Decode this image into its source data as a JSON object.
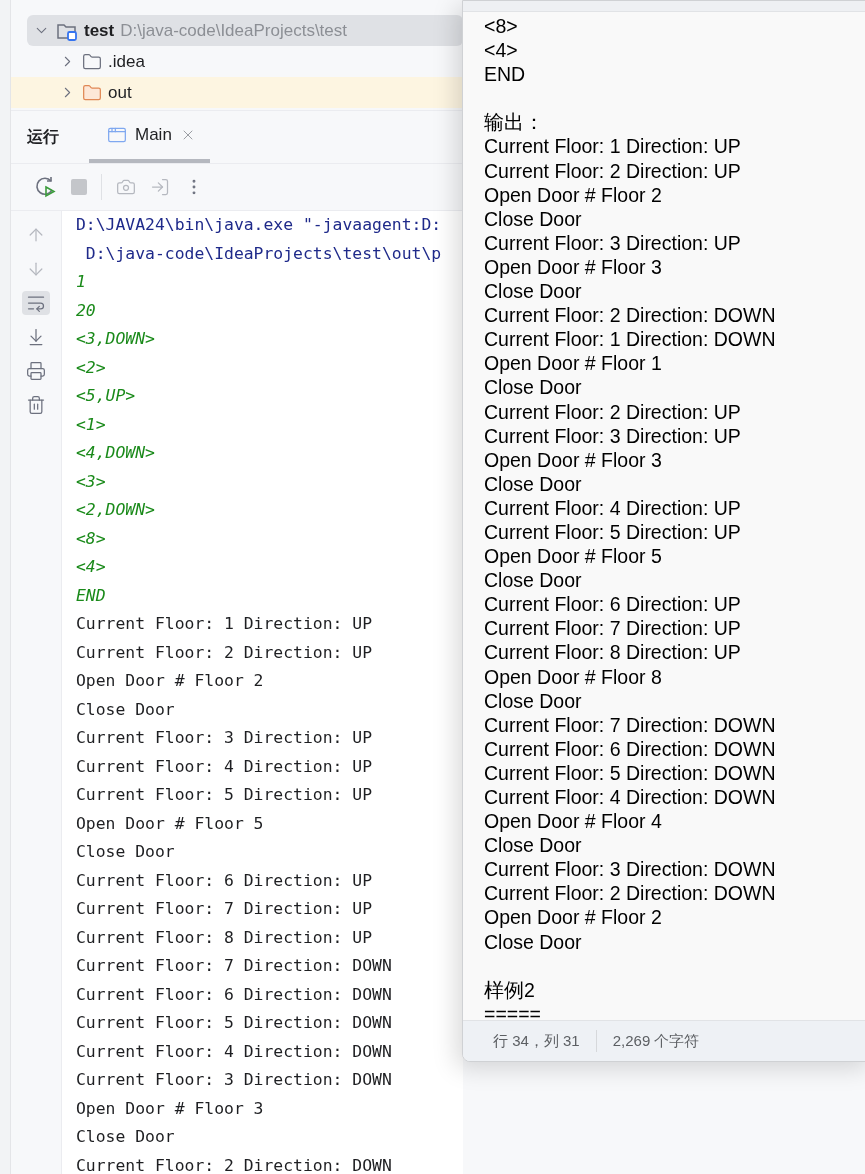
{
  "project_tree": [
    {
      "kind": "project",
      "name": "test",
      "path": "D:\\java-code\\IdeaProjects\\test",
      "expanded": true,
      "selected": true,
      "children": [
        {
          "kind": "folder",
          "name": ".idea",
          "expanded": false,
          "selected": false
        },
        {
          "kind": "excluded",
          "name": "out",
          "expanded": false,
          "selected": false
        }
      ]
    }
  ],
  "run_panel": {
    "title": "运行",
    "tabs": [
      {
        "label": "Main",
        "selected": true
      }
    ]
  },
  "console": {
    "lines": [
      {
        "kind": "command",
        "text": "D:\\JAVA24\\bin\\java.exe \"-javaagent:D:"
      },
      {
        "kind": "command",
        "text": " D:\\java-code\\IdeaProjects\\test\\out\\p"
      },
      {
        "kind": "input",
        "text": "1"
      },
      {
        "kind": "input",
        "text": "20"
      },
      {
        "kind": "input",
        "text": "<3,DOWN>"
      },
      {
        "kind": "input",
        "text": "<2>"
      },
      {
        "kind": "input",
        "text": "<5,UP>"
      },
      {
        "kind": "input",
        "text": "<1>"
      },
      {
        "kind": "input",
        "text": "<4,DOWN>"
      },
      {
        "kind": "input",
        "text": "<3>"
      },
      {
        "kind": "input",
        "text": "<2,DOWN>"
      },
      {
        "kind": "input",
        "text": "<8>"
      },
      {
        "kind": "input",
        "text": "<4>"
      },
      {
        "kind": "input",
        "text": "END"
      },
      {
        "kind": "output",
        "text": "Current Floor: 1 Direction: UP"
      },
      {
        "kind": "output",
        "text": "Current Floor: 2 Direction: UP"
      },
      {
        "kind": "output",
        "text": "Open Door # Floor 2"
      },
      {
        "kind": "output",
        "text": "Close Door"
      },
      {
        "kind": "output",
        "text": "Current Floor: 3 Direction: UP"
      },
      {
        "kind": "output",
        "text": "Current Floor: 4 Direction: UP"
      },
      {
        "kind": "output",
        "text": "Current Floor: 5 Direction: UP"
      },
      {
        "kind": "output",
        "text": "Open Door # Floor 5"
      },
      {
        "kind": "output",
        "text": "Close Door"
      },
      {
        "kind": "output",
        "text": "Current Floor: 6 Direction: UP"
      },
      {
        "kind": "output",
        "text": "Current Floor: 7 Direction: UP"
      },
      {
        "kind": "output",
        "text": "Current Floor: 8 Direction: UP"
      },
      {
        "kind": "output",
        "text": "Current Floor: 7 Direction: DOWN"
      },
      {
        "kind": "output",
        "text": "Current Floor: 6 Direction: DOWN"
      },
      {
        "kind": "output",
        "text": "Current Floor: 5 Direction: DOWN"
      },
      {
        "kind": "output",
        "text": "Current Floor: 4 Direction: DOWN"
      },
      {
        "kind": "output",
        "text": "Current Floor: 3 Direction: DOWN"
      },
      {
        "kind": "output",
        "text": "Open Door # Floor 3"
      },
      {
        "kind": "output",
        "text": "Close Door"
      },
      {
        "kind": "output",
        "text": "Current Floor: 2 Direction: DOWN"
      }
    ],
    "soft_wrap": {
      "on": true
    }
  },
  "notepad": {
    "lines": [
      {
        "kind": "text",
        "text": "<8>"
      },
      {
        "kind": "text",
        "text": "<4>"
      },
      {
        "kind": "text",
        "text": "END"
      },
      {
        "kind": "blank"
      },
      {
        "kind": "text",
        "text": "输出："
      },
      {
        "kind": "text",
        "text": "Current Floor: 1 Direction: UP"
      },
      {
        "kind": "text",
        "text": "Current Floor: 2 Direction: UP"
      },
      {
        "kind": "text",
        "text": "Open Door # Floor 2"
      },
      {
        "kind": "text",
        "text": "Close Door"
      },
      {
        "kind": "text",
        "text": "Current Floor: 3 Direction: UP"
      },
      {
        "kind": "text",
        "text": "Open Door # Floor 3"
      },
      {
        "kind": "text",
        "text": "Close Door"
      },
      {
        "kind": "text",
        "text": "Current Floor: 2 Direction: DOWN"
      },
      {
        "kind": "text",
        "text": "Current Floor: 1 Direction: DOWN"
      },
      {
        "kind": "text",
        "text": "Open Door # Floor 1"
      },
      {
        "kind": "text",
        "text": "Close Door"
      },
      {
        "kind": "text",
        "text": "Current Floor: 2 Direction: UP"
      },
      {
        "kind": "text",
        "text": "Current Floor: 3 Direction: UP"
      },
      {
        "kind": "text",
        "text": "Open Door # Floor 3"
      },
      {
        "kind": "text",
        "text": "Close Door"
      },
      {
        "kind": "text",
        "text": "Current Floor: 4 Direction: UP"
      },
      {
        "kind": "text",
        "text": "Current Floor: 5 Direction: UP"
      },
      {
        "kind": "text",
        "text": "Open Door # Floor 5"
      },
      {
        "kind": "text",
        "text": "Close Door"
      },
      {
        "kind": "text",
        "text": "Current Floor: 6 Direction: UP"
      },
      {
        "kind": "text",
        "text": "Current Floor: 7 Direction: UP"
      },
      {
        "kind": "text",
        "text": "Current Floor: 8 Direction: UP"
      },
      {
        "kind": "text",
        "text": "Open Door # Floor 8"
      },
      {
        "kind": "text",
        "text": "Close Door"
      },
      {
        "kind": "text",
        "text": "Current Floor: 7 Direction: DOWN"
      },
      {
        "kind": "text",
        "text": "Current Floor: 6 Direction: DOWN"
      },
      {
        "kind": "text",
        "text": "Current Floor: 5 Direction: DOWN"
      },
      {
        "kind": "text",
        "text": "Current Floor: 4 Direction: DOWN"
      },
      {
        "kind": "text",
        "text": "Open Door # Floor 4"
      },
      {
        "kind": "text",
        "text": "Close Door"
      },
      {
        "kind": "text",
        "text": "Current Floor: 3 Direction: DOWN"
      },
      {
        "kind": "text",
        "text": "Current Floor: 2 Direction: DOWN"
      },
      {
        "kind": "text",
        "text": "Open Door # Floor 2"
      },
      {
        "kind": "text",
        "text": "Close Door"
      },
      {
        "kind": "blank"
      },
      {
        "kind": "text",
        "text": "样例2"
      },
      {
        "kind": "text",
        "text": "====="
      }
    ],
    "status_bar": {
      "position": "行 34，列 31",
      "char_count": "2,269 个字符"
    }
  }
}
